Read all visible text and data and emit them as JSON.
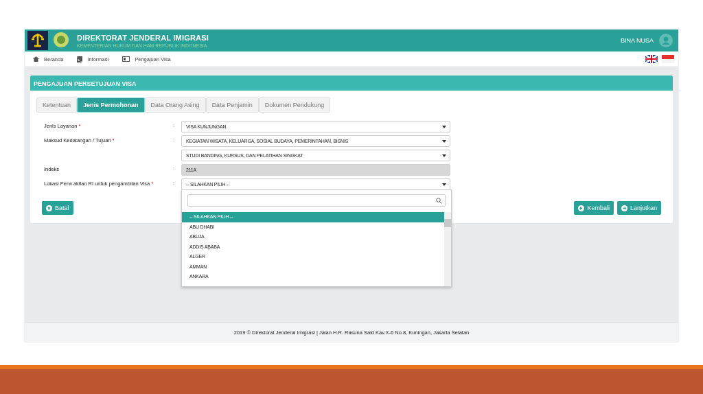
{
  "header": {
    "title": "DIREKTORAT JENDERAL IMIGRASI",
    "subtitle": "KEMENTERIAN HUKUM DAN HAM REPUBLIK INDONESIA",
    "user": "BINA NUSA"
  },
  "nav": [
    {
      "label": "Beranda",
      "kind": "home"
    },
    {
      "label": "Informasi",
      "kind": "book"
    },
    {
      "label": "Pengajuan Visa",
      "kind": "card"
    }
  ],
  "panel": {
    "title": "PENGAJUAN PERSETUJUAN VISA"
  },
  "tabs": [
    {
      "label": "Ketentuan",
      "selected": false
    },
    {
      "label": "Jenis Permohonan",
      "selected": true
    },
    {
      "label": "Data Orang Asing",
      "selected": false
    },
    {
      "label": "Data Penjamin",
      "selected": false
    },
    {
      "label": "Dokumen Pendukung",
      "selected": false
    }
  ],
  "fields": [
    {
      "label": "Jenis Layanan",
      "required_mark": "*",
      "colon": ":",
      "kind": "select",
      "values": [
        "VISA KUNJUNGAN"
      ]
    },
    {
      "label": "Maksud Kedatangan / Tujuan",
      "required_mark": "*",
      "colon": ":",
      "kind": "select",
      "values": [
        "KEGIATAN WISATA, KELUARGA, SOSIAL BUDAYA, PEMERINTAHAN, BISNIS",
        "STUDI BANDING, KURSUS, DAN PELATIHAN SINGKAT"
      ]
    },
    {
      "label": "Indeks",
      "colon": ":",
      "kind": "readonly",
      "values": [
        "211A"
      ]
    },
    {
      "label": "Lokasi Perw akilan RI untuk pengambilan Visa",
      "required_mark": "*",
      "colon": ":",
      "kind": "select",
      "values": [
        "-- SILAHKAN PILIH --"
      ]
    }
  ],
  "dropdown": {
    "options": [
      {
        "label": "-- SILAHKAN PILIH --",
        "selected": true
      },
      {
        "label": "ABU DHABI",
        "selected": false
      },
      {
        "label": "ABUJA",
        "selected": false
      },
      {
        "label": "ADDIS ABABA",
        "selected": false
      },
      {
        "label": "ALGER",
        "selected": false
      },
      {
        "label": "AMMAN",
        "selected": false
      },
      {
        "label": "ANKARA",
        "selected": false
      }
    ]
  },
  "buttons": {
    "left": [
      "Batal"
    ],
    "right": [
      {
        "label": "Kembali",
        "kind": "back"
      },
      {
        "label": "Lanjutkan",
        "kind": "next"
      }
    ]
  },
  "footer": "2019 © Direktorat Jenderal Imigrasi | Jalan H.R. Rasuna Said Kav.X-6 No.8, Kuningan, Jakarta Selatan"
}
